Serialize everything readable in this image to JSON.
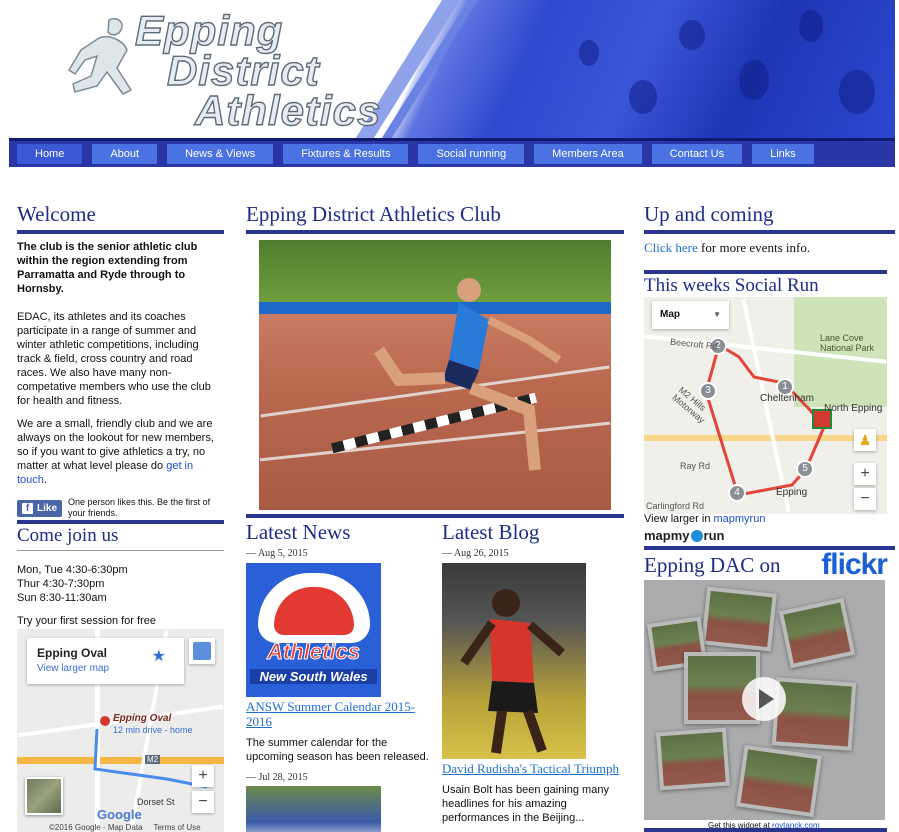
{
  "header": {
    "logo_lines": [
      "Epping",
      "District",
      "Athletics"
    ]
  },
  "nav": {
    "items": [
      {
        "label": "Home",
        "active": true
      },
      {
        "label": "About"
      },
      {
        "label": "News & Views"
      },
      {
        "label": "Fixtures & Results"
      },
      {
        "label": "Social running"
      },
      {
        "label": "Members Area"
      },
      {
        "label": "Contact Us"
      },
      {
        "label": "Links"
      }
    ]
  },
  "welcome": {
    "title": "Welcome",
    "intro": "The club is the senior athletic club within the region extending from Parramatta and Ryde through to Hornsby.",
    "para1": "EDAC, its athletes and its coaches participate in a range of summer and winter athletic competitions, including track & field, cross country and road races. We also have many non-competative members who use the club for health and fitness.",
    "para2_prefix": "We are a small, friendly club and we are always on the lookout for new members, so if you want to give athletics a try, no matter at what level please do ",
    "para2_link": "get in touch",
    "para2_suffix": ".",
    "fb_like": "Like",
    "fb_text": "One person likes this. Be the first of your friends."
  },
  "join": {
    "title": "Come join us",
    "times": [
      "Mon, Tue 4:30-6:30pm",
      "Thur 4:30-7:30pm",
      "Sun 8:30-11:30am"
    ],
    "note": "Try your first session for free",
    "map_place": "Epping Oval",
    "map_link": "View larger map",
    "map_marker": "Epping Oval",
    "map_drive": "12 min drive - home",
    "map_road": "M2",
    "map_street": "Dorset St",
    "map_footer": "©2016 Google - Map Data     Terms of Use",
    "google": "Google"
  },
  "club": {
    "title": "Epping District Athletics Club"
  },
  "news": {
    "title": "Latest News",
    "items": [
      {
        "date": "— Aug 5, 2015",
        "headline": "ANSW Summer Calendar 2015-2016",
        "summary": "The summer calendar for the upcoming season has been released.",
        "logo_top": "Athletics",
        "logo_bottom": "New South Wales"
      },
      {
        "date": "— Jul 28, 2015"
      }
    ]
  },
  "blog": {
    "title": "Latest Blog",
    "date": "— Aug 26, 2015",
    "headline": "David Rudisha's Tactical Triumph",
    "summary": "Usain Bolt has been gaining many headlines for his amazing performances in the Beijing..."
  },
  "upcoming": {
    "title": "Up and coming",
    "link": "Click here",
    "text": " for more events info."
  },
  "social": {
    "title": "This weeks Social Run",
    "map_select": "Map",
    "labels": [
      "Beecroft Rd",
      "Lane Cove National Park",
      "Cheltenham",
      "North Epping",
      "M2 Hills Motorway",
      "Ray Rd",
      "Epping",
      "Carlingford Rd"
    ],
    "waypoints": [
      "1",
      "2",
      "3",
      "4",
      "5"
    ],
    "view_prefix": "View larger in ",
    "view_link": "mapmyrun",
    "brand": "mapmy",
    "brand_suffix": "run"
  },
  "flickr": {
    "title": "Epping DAC on",
    "brand": "flickr",
    "credit_prefix": "Get this widget at ",
    "credit_link": "roytanck.com"
  }
}
